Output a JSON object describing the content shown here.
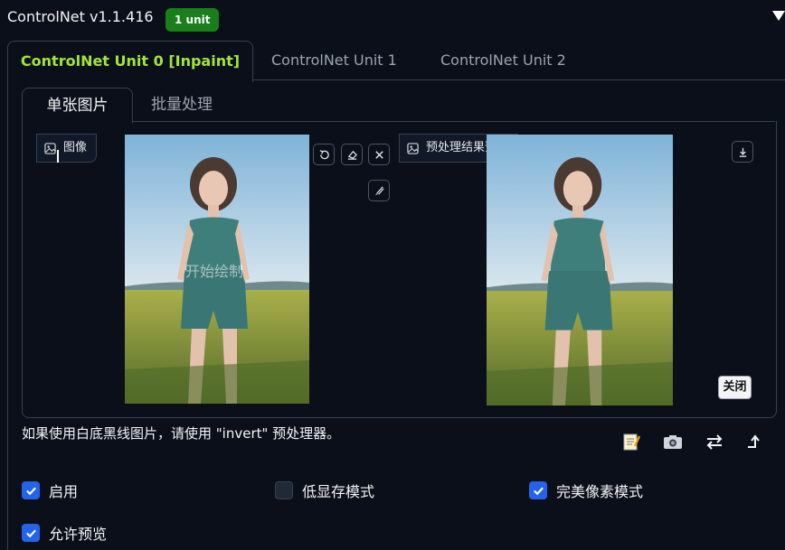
{
  "header": {
    "title": "ControlNet v1.1.416",
    "badge": "1 unit",
    "collapse_icon": "triangle-down-icon"
  },
  "unit_tabs": [
    {
      "label": "ControlNet Unit 0 [Inpaint]",
      "active": true
    },
    {
      "label": "ControlNet Unit 1",
      "active": false
    },
    {
      "label": "ControlNet Unit 2",
      "active": false
    }
  ],
  "mode_tabs": [
    {
      "label": "单张图片",
      "active": true
    },
    {
      "label": "批量处理",
      "active": false
    }
  ],
  "input_image": {
    "label": "图像",
    "overlay_text": "开始绘制",
    "tools": [
      "undo-icon",
      "eraser-icon",
      "close-icon",
      "brush-icon"
    ]
  },
  "preview_image": {
    "label": "预处理结果预览",
    "download_icon": "download-icon",
    "close_label": "关闭"
  },
  "hint": "如果使用白底黑线图片，请使用 \"invert\" 预处理器。",
  "toolbar_icons": [
    "memo-icon",
    "camera-icon",
    "swap-icon",
    "send-dimensions-icon"
  ],
  "options": [
    {
      "label": "启用",
      "checked": true
    },
    {
      "label": "低显存模式",
      "checked": false
    },
    {
      "label": "完美像素模式",
      "checked": true
    },
    {
      "label": "允许预览",
      "checked": true
    }
  ],
  "colors": {
    "accent_tab": "#a3e635",
    "badge": "#1a7f1a",
    "checkbox": "#2563eb",
    "background": "#0b0f19"
  }
}
